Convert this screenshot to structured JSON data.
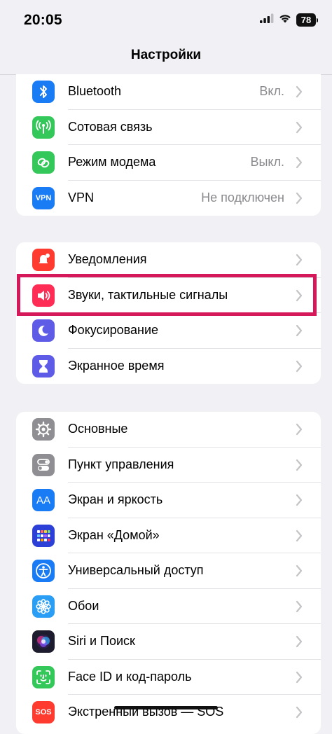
{
  "status_bar": {
    "time": "20:05",
    "battery": "78"
  },
  "nav": {
    "title": "Настройки"
  },
  "groups": [
    {
      "items": [
        {
          "label": "Bluetooth",
          "value": "Вкл.",
          "icon": "bluetooth-icon",
          "color": "#1a7cf5"
        },
        {
          "label": "Сотовая связь",
          "value": "",
          "icon": "antenna-icon",
          "color": "#34c759"
        },
        {
          "label": "Режим модема",
          "value": "Выкл.",
          "icon": "link-chain-icon",
          "color": "#34c759"
        },
        {
          "label": "VPN",
          "value": "Не подключен",
          "icon": "vpn-icon",
          "color": "#1a7cf5",
          "icon_text": "VPN"
        }
      ]
    },
    {
      "items": [
        {
          "label": "Уведомления",
          "value": "",
          "icon": "bell-icon",
          "color": "#ff3b30"
        },
        {
          "label": "Звуки, тактильные сигналы",
          "value": "",
          "icon": "speaker-icon",
          "color": "#ff2d55"
        },
        {
          "label": "Фокусирование",
          "value": "",
          "icon": "moon-icon",
          "color": "#5e5ce6"
        },
        {
          "label": "Экранное время",
          "value": "",
          "icon": "hourglass-icon",
          "color": "#5e5ce6"
        }
      ]
    },
    {
      "items": [
        {
          "label": "Основные",
          "value": "",
          "icon": "gear-icon",
          "color": "#8e8e93"
        },
        {
          "label": "Пункт управления",
          "value": "",
          "icon": "toggles-icon",
          "color": "#8e8e93"
        },
        {
          "label": "Экран и яркость",
          "value": "",
          "icon": "text-size-icon",
          "color": "#1a7cf5",
          "icon_text": "AA"
        },
        {
          "label": "Экран «Домой»",
          "value": "",
          "icon": "home-grid-icon",
          "color": "#2c3fd6"
        },
        {
          "label": "Универсальный доступ",
          "value": "",
          "icon": "accessibility-icon",
          "color": "#1a7cf5"
        },
        {
          "label": "Обои",
          "value": "",
          "icon": "flower-icon",
          "color": "#2a9df4"
        },
        {
          "label": "Siri и Поиск",
          "value": "",
          "icon": "siri-icon",
          "color": "#1c1c2e"
        },
        {
          "label": "Face ID и код-пароль",
          "value": "",
          "icon": "face-id-icon",
          "color": "#34c759"
        },
        {
          "label": "Экстренный вызов — SOS",
          "value": "",
          "icon": "sos-icon",
          "color": "#ff3b30",
          "icon_text": "SOS"
        }
      ]
    }
  ]
}
